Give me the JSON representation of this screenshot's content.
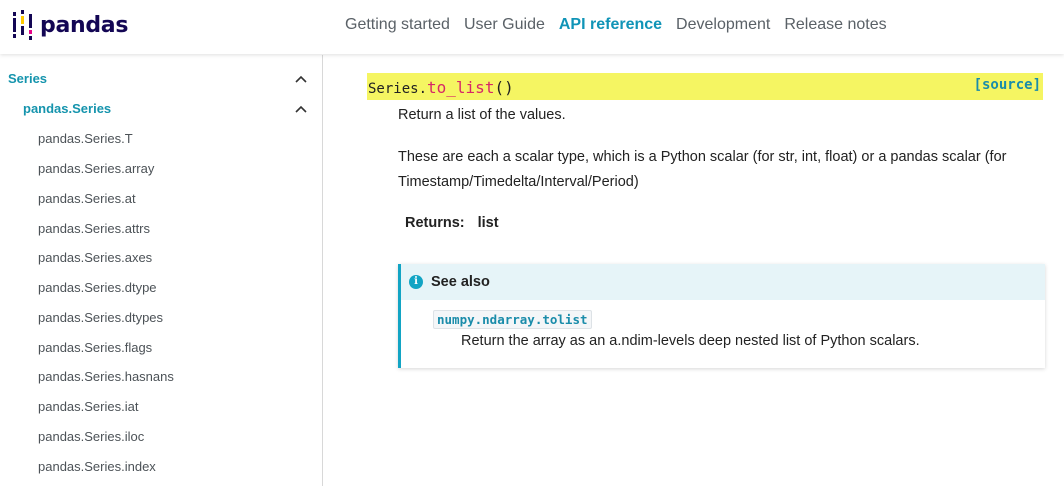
{
  "header": {
    "logo_text": "pandas",
    "nav": [
      {
        "label": "Getting started",
        "active": false
      },
      {
        "label": "User Guide",
        "active": false
      },
      {
        "label": "API reference",
        "active": true
      },
      {
        "label": "Development",
        "active": false
      },
      {
        "label": "Release notes",
        "active": false
      }
    ]
  },
  "sidebar": {
    "section": "Series",
    "subsection": "pandas.Series",
    "items": [
      "pandas.Series.T",
      "pandas.Series.array",
      "pandas.Series.at",
      "pandas.Series.attrs",
      "pandas.Series.axes",
      "pandas.Series.dtype",
      "pandas.Series.dtypes",
      "pandas.Series.flags",
      "pandas.Series.hasnans",
      "pandas.Series.iat",
      "pandas.Series.iloc",
      "pandas.Series.index"
    ]
  },
  "main": {
    "signature": {
      "class_prefix": "Series.",
      "function": "to_list",
      "parens": "()",
      "source_link": "[source]"
    },
    "summary": "Return a list of the values.",
    "description_line1": "These are each a scalar type, which is a Python scalar (for str, int, float) or a pandas scalar (for",
    "description_line2": "Timestamp/Timedelta/Interval/Period)",
    "returns_label": "Returns:",
    "returns_value": "list",
    "see_also": {
      "icon": "info-icon",
      "title": "See also",
      "link": "numpy.ndarray.tolist",
      "description": "Return the array as an a.ndim-levels deep nested list of Python scalars."
    }
  },
  "colors": {
    "accent": "#1594ad",
    "logo": "#130654",
    "signature_bg": "#f5f562",
    "function_name": "#d62767"
  }
}
